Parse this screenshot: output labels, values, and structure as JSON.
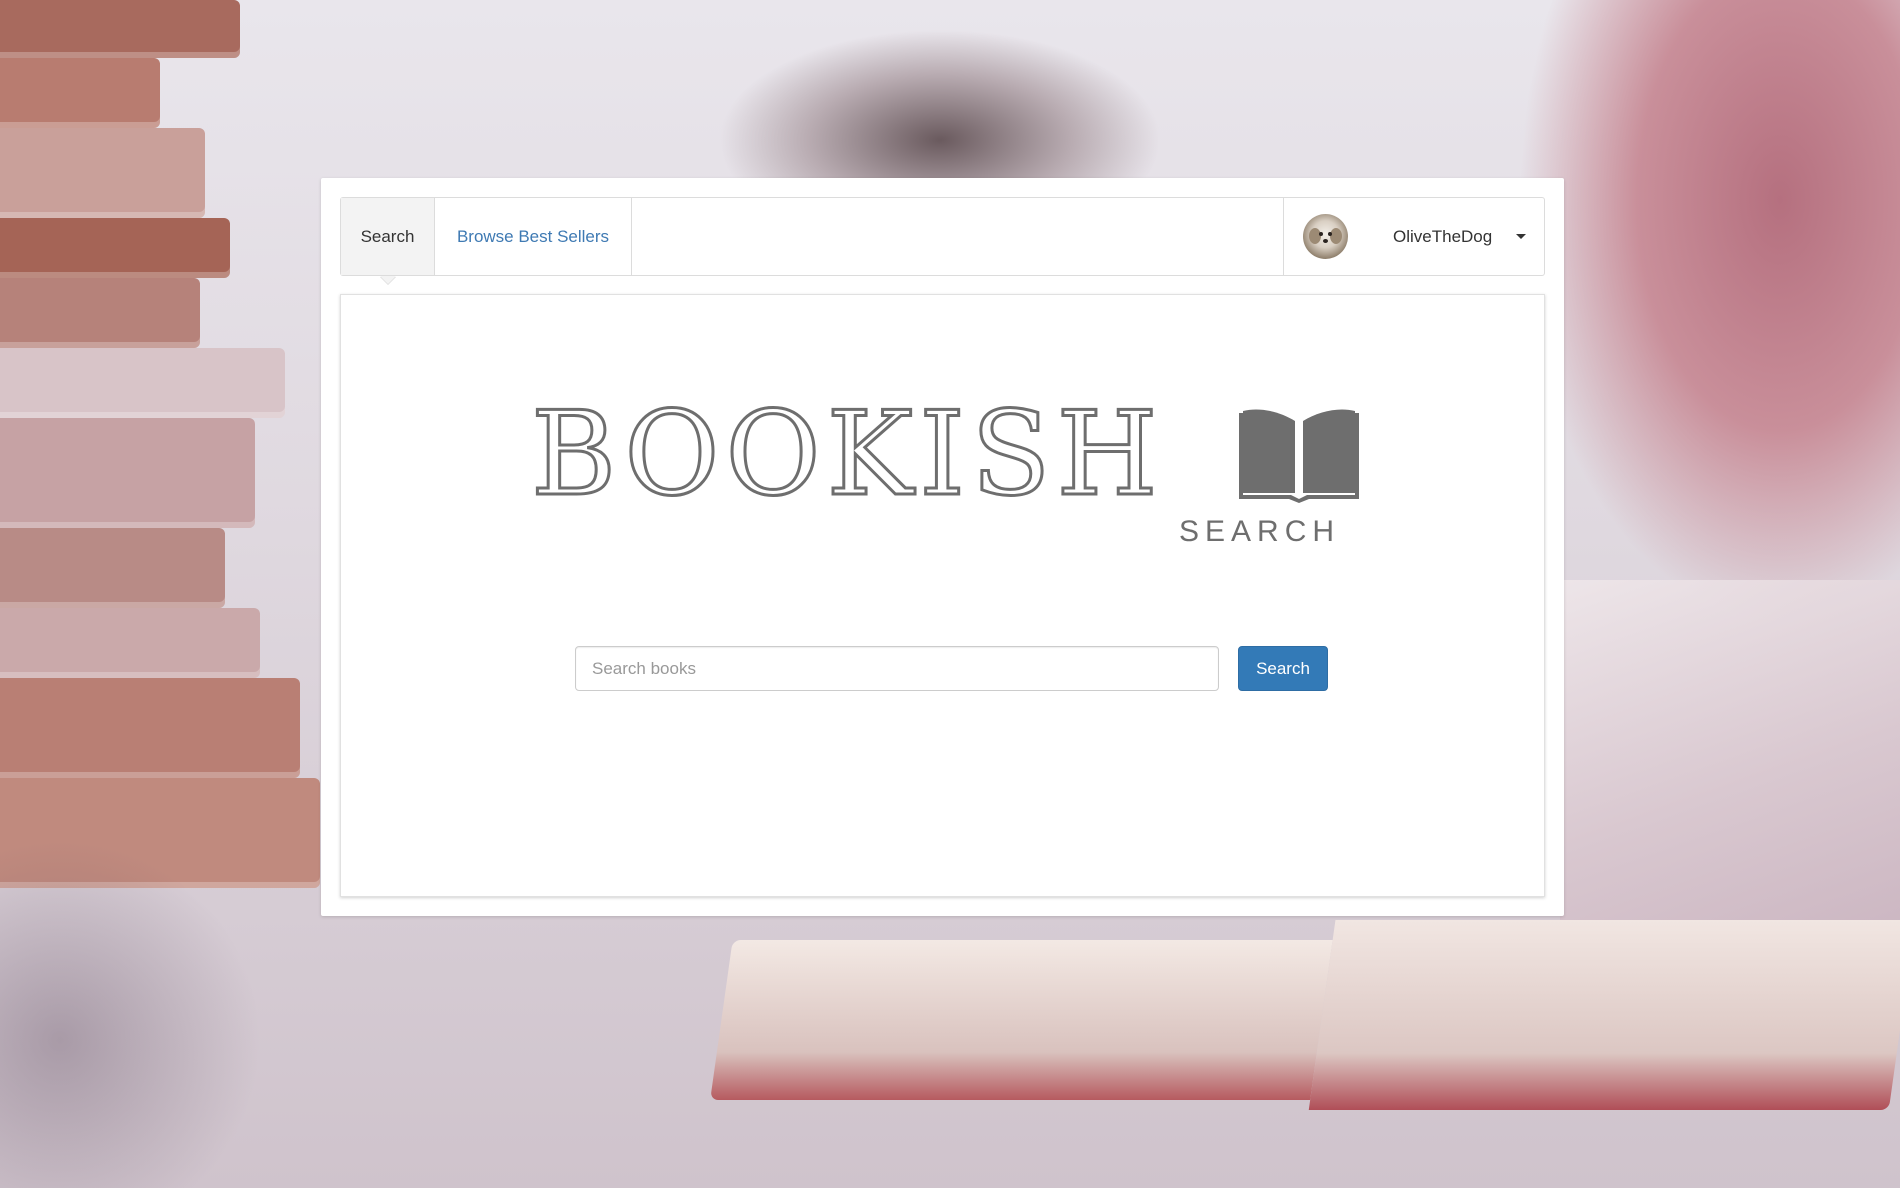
{
  "nav": {
    "tabs": [
      {
        "label": "Search",
        "active": true
      },
      {
        "label": "Browse Best Sellers",
        "active": false
      }
    ],
    "user": {
      "name": "OliveTheDog",
      "avatar_icon": "dog-avatar",
      "menu_icon": "caret-down-icon"
    }
  },
  "logo": {
    "title": "BOOKISH",
    "subtitle": "SEARCH",
    "icon": "open-book-icon",
    "color": "#6e6e6e"
  },
  "search": {
    "placeholder": "Search books",
    "value": "",
    "button_label": "Search",
    "button_color": "#337ab7"
  },
  "colors": {
    "link": "#3f7ab3",
    "active_tab_bg": "#f3f3f3"
  }
}
